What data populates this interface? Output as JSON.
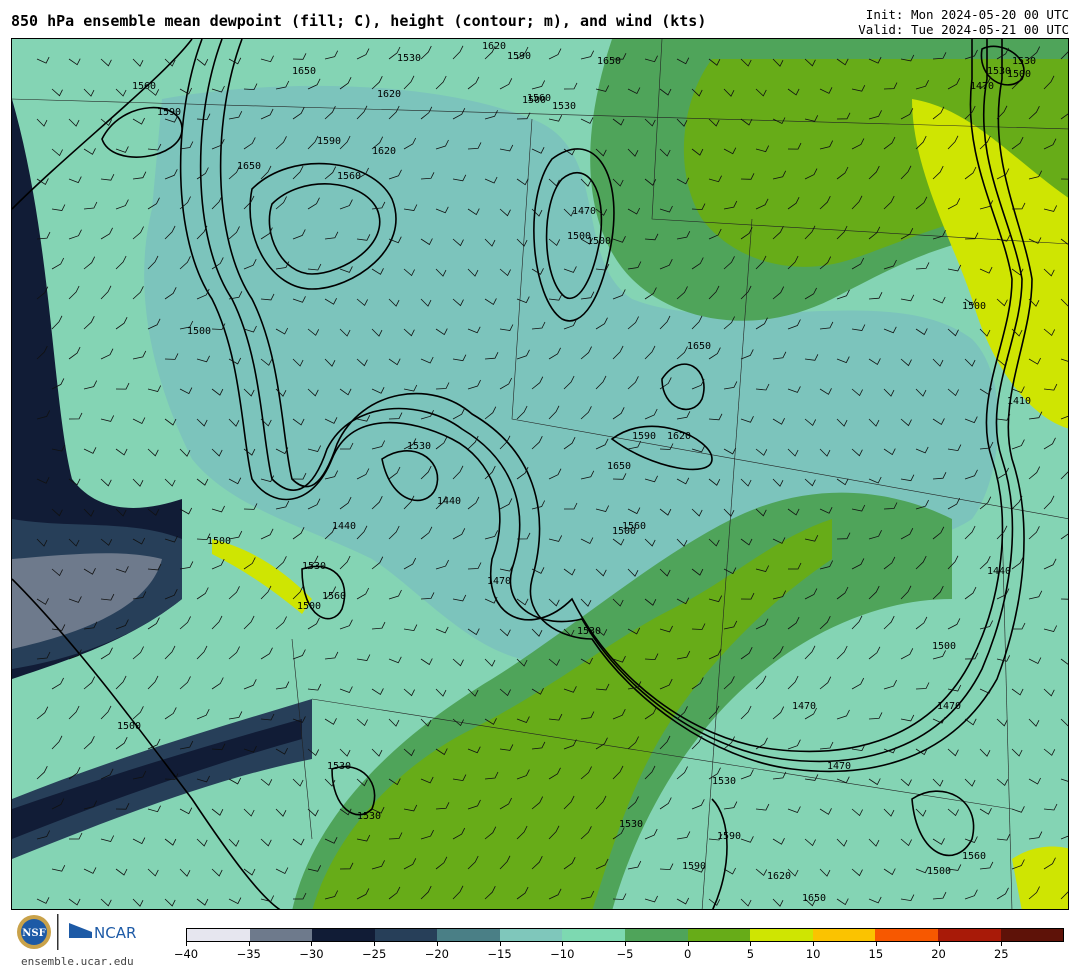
{
  "header": {
    "title": "850 hPa ensemble mean dewpoint (fill; C), height (contour; m), and wind (kts)",
    "init": "Init: Mon 2024-05-20 00 UTC",
    "valid": "Valid: Tue 2024-05-21 00 UTC"
  },
  "footer": {
    "site": "ensemble.ucar.edu",
    "nsf_logo": "NSF",
    "ncar_logo": "NCAR"
  },
  "colorbar": {
    "colors": [
      "#e6e6ef",
      "#6e7a8c",
      "#111c36",
      "#273f59",
      "#4a7f86",
      "#7fc7bb",
      "#7dd9b1",
      "#4fa45a",
      "#67ac18",
      "#cfe502",
      "#fbc300",
      "#f75800",
      "#a81a08",
      "#5e1208"
    ],
    "tick_labels": [
      "-40",
      "-35",
      "-30",
      "-25",
      "-20",
      "-15",
      "-10",
      "-5",
      "0",
      "5",
      "10",
      "15",
      "20",
      "25"
    ]
  },
  "contour_labels": [
    "1560",
    "1590",
    "1650",
    "1620",
    "1530",
    "1590",
    "1560",
    "1650",
    "1620",
    "1530",
    "1500",
    "1470",
    "1530",
    "1500",
    "1530",
    "1590",
    "1620",
    "1650",
    "1500",
    "1470",
    "1500",
    "1560",
    "1500",
    "1440",
    "1530",
    "1650",
    "1590",
    "1620",
    "1650",
    "1500",
    "1440",
    "1500",
    "1530",
    "1560",
    "1500",
    "1470",
    "1530",
    "1410",
    "1440",
    "1500",
    "1470",
    "1470",
    "1470",
    "1530",
    "1590",
    "1530",
    "1560",
    "1590",
    "1620",
    "1650",
    "1500",
    "1530",
    "1500",
    "1530",
    "1560",
    "1500"
  ]
}
